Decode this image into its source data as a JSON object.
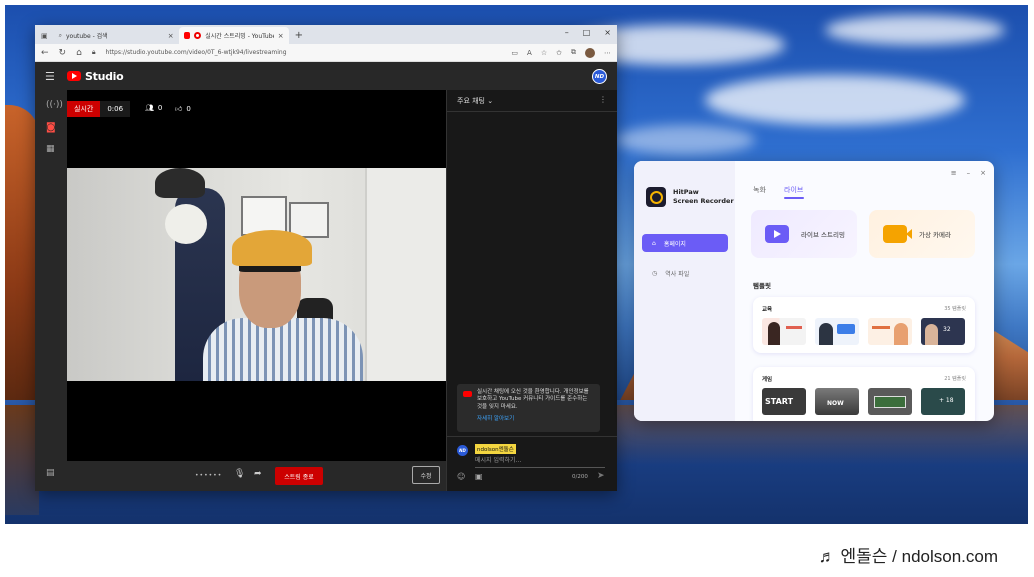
{
  "browser": {
    "tabs": [
      {
        "label": "youtube - 검색",
        "close": "×"
      },
      {
        "label": "실시간 스트리밍 - YouTube",
        "close": "×"
      }
    ],
    "new_tab": "+",
    "window_controls": {
      "minimize": "–",
      "maximize": "□",
      "close": "×"
    },
    "url": "https://studio.youtube.com/video/0T_6-wtjk94/livestreaming"
  },
  "studio": {
    "title": "Studio",
    "avatar": "ND",
    "live_label": "실시간",
    "live_time": "0:06",
    "viewers": "0",
    "likes": "0",
    "end_stream_label": "스트림 종료",
    "edit_label": "수정",
    "mic_level": "••••••"
  },
  "chat": {
    "header": "주요 채팅 ⌄",
    "notice_text": "실시간 채팅에 오신 것을 환영합니다. 개인정보를 보호하고 YouTube 커뮤니티 가이드를 준수하는 것을 잊지 마세요.",
    "notice_link": "자세히 알아보기",
    "username": "ndolson엔돌슨",
    "avatar": "ND",
    "placeholder": "메시지 입력하기...",
    "char_count": "0/200"
  },
  "hitpaw": {
    "app_name_line1": "HitPaw",
    "app_name_line2": "Screen Recorder",
    "nav_home": "홈페이지",
    "nav_history": "역사 파일",
    "tab_record": "녹화",
    "tab_live": "라이브",
    "card_live": "라이브 스트리밍",
    "card_cam": "가상 카메라",
    "section_templates": "템플릿",
    "edu_title": "교육",
    "edu_count": "35 템플릿",
    "game_title": "게임",
    "game_count": "21 템플릿",
    "thumb_32": "32",
    "thumb_18": "+ 18",
    "thumb_start": "START",
    "thumb_now": "NOW",
    "colors": {
      "accent": "#6b5cf6",
      "cam_orange": "#f5a300"
    }
  },
  "watermark": "♬ 엔돌슨 / ndolson.com"
}
